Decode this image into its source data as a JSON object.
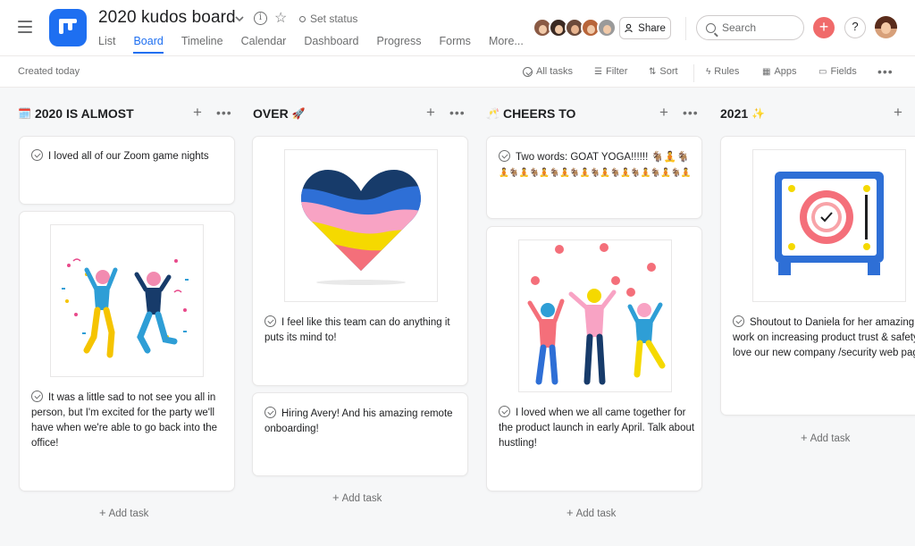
{
  "header": {
    "title": "2020 kudos board",
    "status": "Set status",
    "tabs": [
      "List",
      "Board",
      "Timeline",
      "Calendar",
      "Dashboard",
      "Progress",
      "Forms",
      "More..."
    ],
    "active_tab": "Board",
    "share_label": "Share",
    "search_placeholder": "Search",
    "brand_color": "#1e6ff1",
    "accent_color": "#f06a6a"
  },
  "toolbar": {
    "created": "Created today",
    "all_tasks": "All tasks",
    "filter": "Filter",
    "sort": "Sort",
    "rules": "Rules",
    "apps": "Apps",
    "fields": "Fields"
  },
  "columns": [
    {
      "title": "2020 IS ALMOST",
      "emoji": "🗓️",
      "cards": [
        {
          "text": "I loved all of our Zoom game nights",
          "image": null
        },
        {
          "text": "It was a little sad to not see you all in person, but I'm excited for the party we'll have when we're able to go back into the office!",
          "image": "dancing-people-illustration"
        }
      ],
      "add_task": "Add task"
    },
    {
      "title": "OVER",
      "emoji": "🚀",
      "cards": [
        {
          "text": "I feel like this team can do anything it puts its mind to!",
          "image": "heart-illustration"
        },
        {
          "text": "Hiring Avery! And his amazing remote onboarding!",
          "image": null
        }
      ],
      "add_task": "Add task"
    },
    {
      "title": "CHEERS TO",
      "emoji": "🥂",
      "cards": [
        {
          "text": "Two words: GOAT YOGA!!!!!! 🐐🧘🐐",
          "text2": "🧘🐐🧘🐐🧘🐐🧘🐐🧘🐐🧘🐐🧘🐐🧘🐐🧘🐐🧘",
          "image": null
        },
        {
          "text": "I loved when we all came together for the product launch in early April. Talk about hustling!",
          "image": "juggling-people-illustration"
        }
      ],
      "add_task": "Add task"
    },
    {
      "title": "2021",
      "emoji": "✨",
      "cards": [
        {
          "text": "Shoutout to Daniela for her amazing work on increasing product trust & safety! I love our new company /security web page!",
          "image": "safe-illustration"
        }
      ],
      "add_task": "Add task"
    }
  ]
}
